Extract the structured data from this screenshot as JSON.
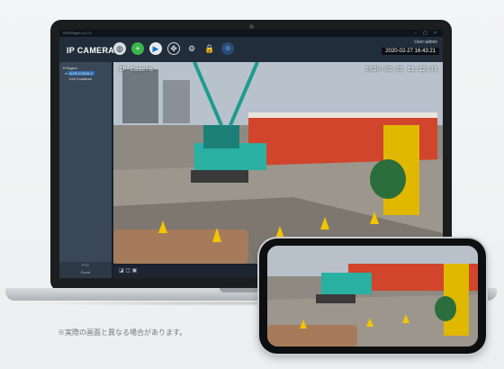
{
  "app": {
    "window_title": "NVRPlayer v1.0.0",
    "brand": "IP CAMERA",
    "user_label": "User:admin",
    "datetime": "2020-02-27 16:43:21",
    "window_controls": "- ▢ ×"
  },
  "toolbar": {
    "tools": [
      {
        "icon": "globe-icon",
        "glyph": "◍"
      },
      {
        "icon": "add-icon",
        "glyph": "+"
      },
      {
        "icon": "playback-icon",
        "glyph": "▶"
      },
      {
        "icon": "ptz-icon",
        "glyph": "✥"
      },
      {
        "icon": "settings-icon",
        "glyph": "⚙"
      },
      {
        "icon": "lock-icon",
        "glyph": "🔒"
      },
      {
        "icon": "location-icon",
        "glyph": "⌾"
      }
    ]
  },
  "sidebar": {
    "tree_root": "Region",
    "tree_device": "NVR-IOSN8-9",
    "tree_group": "Cell Container",
    "footer_top": "PTZ",
    "footer_bottom": "Event"
  },
  "camera": {
    "name": "IP Camera",
    "timestamp": "2020-02-25 11:12:33"
  },
  "viewer_bar": {
    "controls": "◪ ◫ ▣"
  },
  "caption": "※実際の画面と異なる場合があります。",
  "colors": {
    "app_bg": "#212d3a",
    "sidebar_bg": "#3a4756",
    "accent": "#2f6fb3"
  }
}
